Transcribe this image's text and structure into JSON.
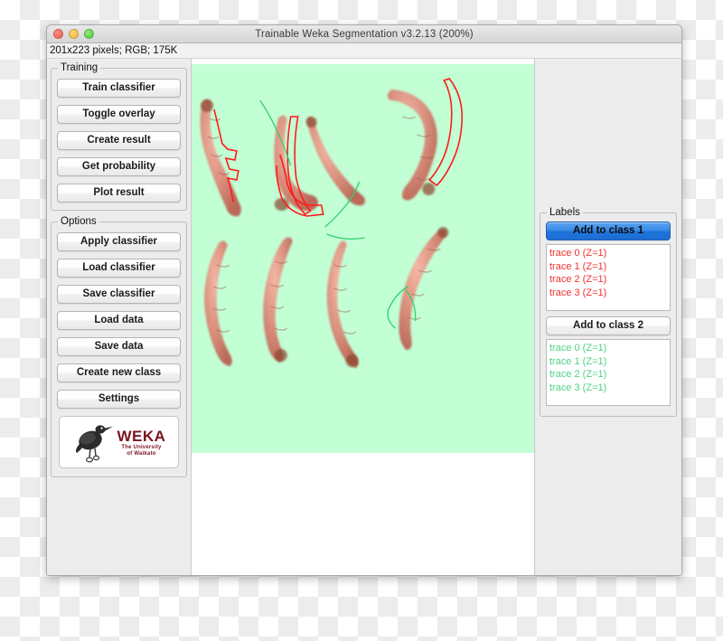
{
  "window": {
    "title": "Trainable Weka Segmentation v3.2.13 (200%)",
    "traffic_lights": [
      "close-button",
      "minimize-button",
      "zoom-button"
    ],
    "status_text": "201x223 pixels; RGB; 175K"
  },
  "left_panel": {
    "training": {
      "legend": "Training",
      "buttons": [
        {
          "label": "Train classifier",
          "name": "train-classifier-button"
        },
        {
          "label": "Toggle overlay",
          "name": "toggle-overlay-button"
        },
        {
          "label": "Create result",
          "name": "create-result-button"
        },
        {
          "label": "Get probability",
          "name": "get-probability-button"
        },
        {
          "label": "Plot result",
          "name": "plot-result-button"
        }
      ]
    },
    "options": {
      "legend": "Options",
      "buttons": [
        {
          "label": "Apply classifier",
          "name": "apply-classifier-button"
        },
        {
          "label": "Load classifier",
          "name": "load-classifier-button"
        },
        {
          "label": "Save classifier",
          "name": "save-classifier-button"
        },
        {
          "label": "Load data",
          "name": "load-data-button"
        },
        {
          "label": "Save data",
          "name": "save-data-button"
        },
        {
          "label": "Create new class",
          "name": "create-new-class-button"
        },
        {
          "label": "Settings",
          "name": "settings-button"
        }
      ]
    },
    "logo": {
      "wordmark": "WEKA",
      "line1": "The University",
      "line2": "of Waikato",
      "icon": "weka-bird-icon",
      "color": "#7a1520"
    }
  },
  "right_panel": {
    "labels": {
      "legend": "Labels",
      "class1": {
        "button_label": "Add to class 1",
        "button_color": "#2f86e0",
        "trace_color": "#f03030",
        "traces": [
          "trace 0 (Z=1)",
          "trace 1 (Z=1)",
          "trace 2 (Z=1)",
          "trace 3 (Z=1)"
        ]
      },
      "class2": {
        "button_label": "Add to class 2",
        "button_color": "#f2f2f2",
        "trace_color": "#4fd183",
        "traces": [
          "trace 0 (Z=1)",
          "trace 1 (Z=1)",
          "trace 2 (Z=1)",
          "trace 3 (Z=1)"
        ]
      }
    }
  },
  "canvas": {
    "name": "segmentation-image-canvas",
    "background_color": "#c2ffd4",
    "description": "Microscope image of eight reddish larvae on a light green background with red class-1 traces and green class-2 traces drawn on top.",
    "class1_trace_color": "#ff1a1a",
    "class2_trace_color": "#31d06e"
  }
}
